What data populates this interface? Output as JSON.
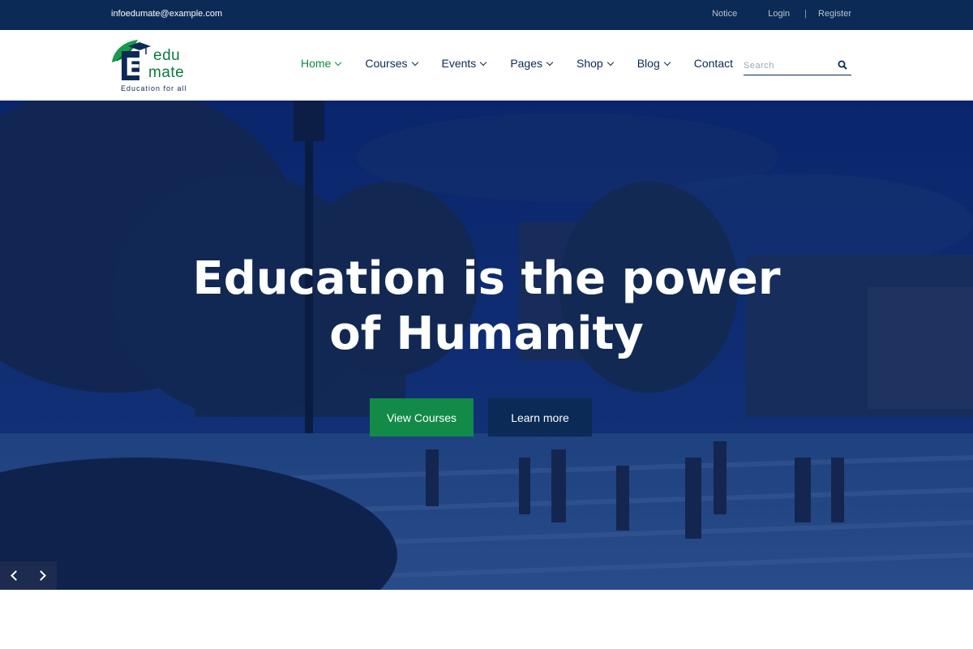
{
  "topbar": {
    "email": "infoedumate@example.com",
    "notice": "Notice",
    "login": "Login",
    "separator": "|",
    "register": "Register"
  },
  "logo": {
    "line1": "edu",
    "line2": "mate",
    "tagline": "Education for all",
    "letter": "E"
  },
  "nav": {
    "items": [
      {
        "label": "Home",
        "has_dropdown": true,
        "active": true
      },
      {
        "label": "Courses",
        "has_dropdown": true
      },
      {
        "label": "Events",
        "has_dropdown": true
      },
      {
        "label": "Pages",
        "has_dropdown": true
      },
      {
        "label": "Shop",
        "has_dropdown": true
      },
      {
        "label": "Blog",
        "has_dropdown": true
      },
      {
        "label": "Contact",
        "has_dropdown": false
      }
    ]
  },
  "search": {
    "placeholder": "Search",
    "icon": "search-icon"
  },
  "hero": {
    "title_line1": "Education is the power",
    "title_line2": "of Humanity",
    "primary_button": "View Courses",
    "secondary_button": "Learn more"
  },
  "slider": {
    "prev_icon": "chevron-left-icon",
    "next_icon": "chevron-right-icon"
  },
  "colors": {
    "navy": "#0b2a55",
    "green": "#128a48",
    "active_nav": "#0e8a42"
  }
}
